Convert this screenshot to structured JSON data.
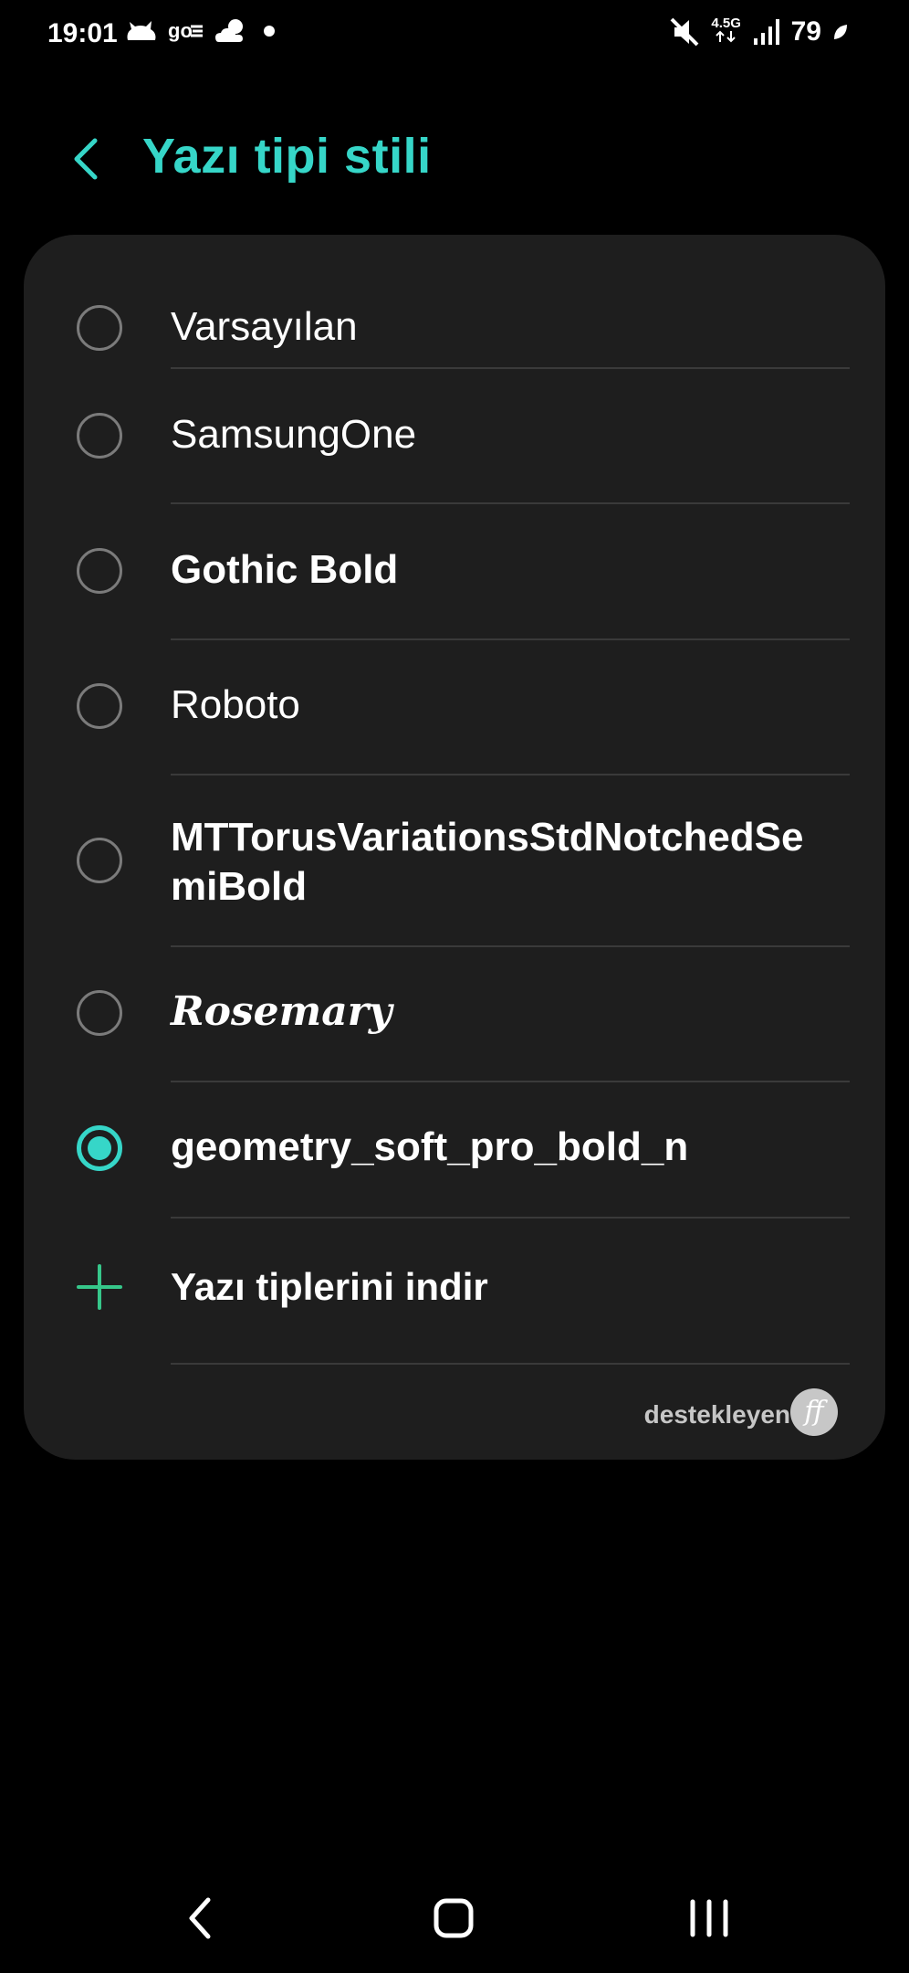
{
  "status_bar": {
    "time": "19:01",
    "network": "4.5G",
    "battery": "79",
    "icons": [
      "cat-icon",
      "go-icon",
      "weather-icon",
      "dot-icon",
      "mute-icon",
      "signal-icon",
      "leaf-icon"
    ]
  },
  "header": {
    "title": "Yazı tipi stili",
    "accent_color": "#36d6c8"
  },
  "fonts": {
    "items": [
      {
        "label": "Varsayılan",
        "selected": false
      },
      {
        "label": "SamsungOne",
        "selected": false
      },
      {
        "label": "Gothic Bold",
        "selected": false
      },
      {
        "label": "Roboto",
        "selected": false
      },
      {
        "label": "MTTorusVariationsStdNotchedSe miBold",
        "selected": false
      },
      {
        "label": "Rosemary",
        "selected": false
      },
      {
        "label": "geometry_soft_pro_bold_n",
        "selected": true
      }
    ],
    "download_label": "Yazı tiplerini indir",
    "credit": "destekleyen",
    "credit_logo": "ff"
  }
}
